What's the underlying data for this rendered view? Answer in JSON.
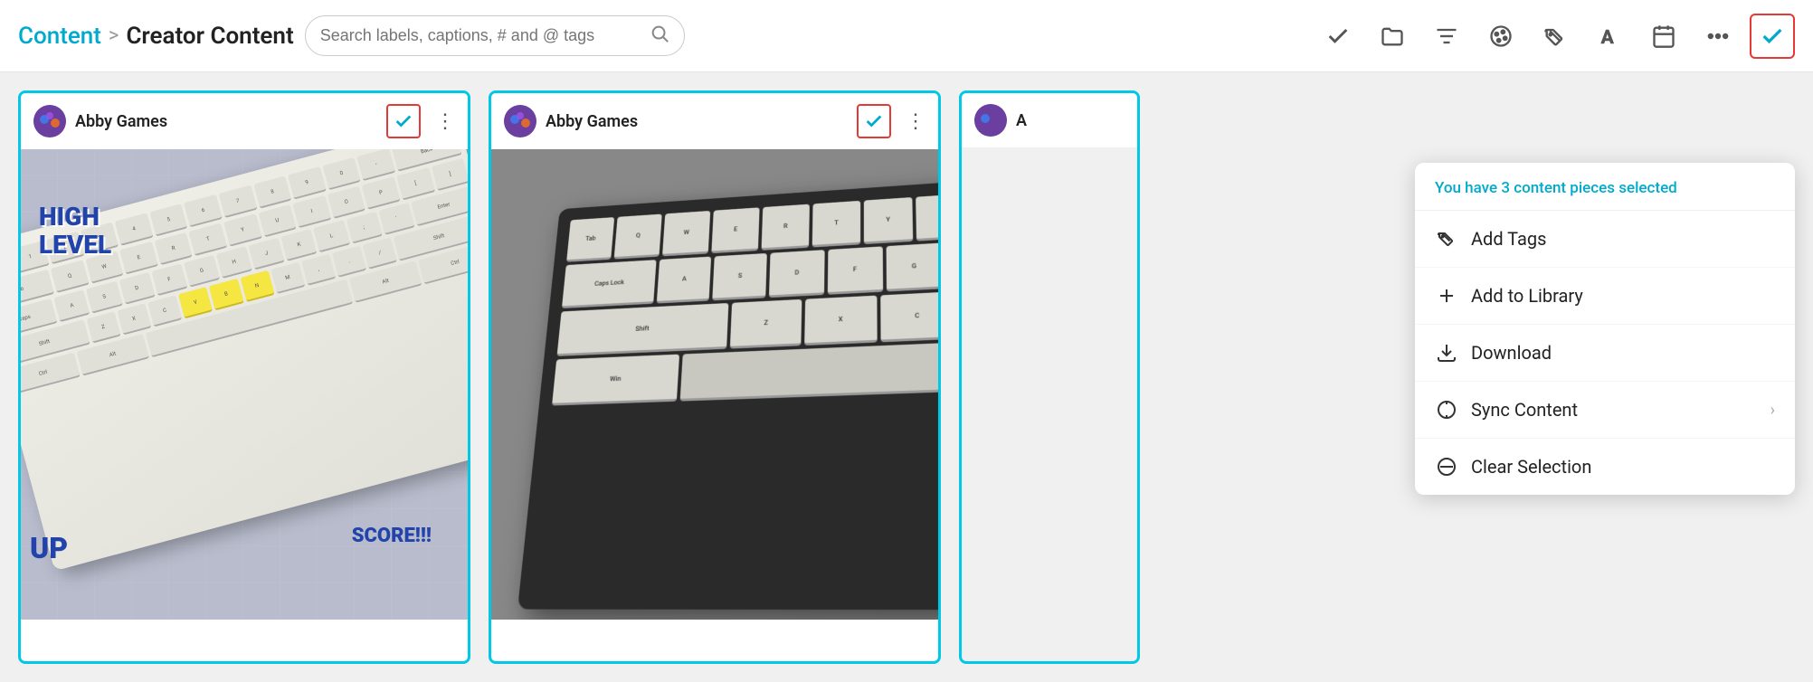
{
  "breadcrumb": {
    "parent": "Content",
    "separator": ">",
    "current": "Creator Content"
  },
  "search": {
    "placeholder": "Search labels, captions, # and @ tags"
  },
  "toolbar": {
    "icons": [
      {
        "name": "checkmark-icon",
        "label": "✓"
      },
      {
        "name": "folder-icon",
        "label": "folder"
      },
      {
        "name": "filter-icon",
        "label": "filter"
      },
      {
        "name": "palette-icon",
        "label": "palette"
      },
      {
        "name": "tag-icon",
        "label": "tags"
      },
      {
        "name": "text-icon",
        "label": "A"
      },
      {
        "name": "calendar-icon",
        "label": "calendar"
      },
      {
        "name": "more-icon",
        "label": "..."
      }
    ]
  },
  "selection_notice": "You have 3 content pieces selected",
  "dropdown_menu": {
    "items": [
      {
        "id": "add-tags",
        "label": "Add Tags",
        "icon": "tag",
        "has_chevron": false
      },
      {
        "id": "add-to-library",
        "label": "Add to Library",
        "icon": "plus",
        "has_chevron": false
      },
      {
        "id": "download",
        "label": "Download",
        "icon": "download",
        "has_chevron": false
      },
      {
        "id": "sync-content",
        "label": "Sync Content",
        "icon": "sync",
        "has_chevron": true
      },
      {
        "id": "clear-selection",
        "label": "Clear Selection",
        "icon": "ban",
        "has_chevron": false
      }
    ]
  },
  "cards": [
    {
      "id": "card-1",
      "user": "Abby Games",
      "selected": true,
      "image_type": "keyboard1"
    },
    {
      "id": "card-2",
      "user": "Abby Games",
      "selected": true,
      "image_type": "keyboard2"
    },
    {
      "id": "card-3",
      "user": "A",
      "selected": false,
      "image_type": "partial"
    }
  ],
  "colors": {
    "accent": "#00c8e6",
    "accent_text": "#00aacc",
    "check_border": "#e53935",
    "check_color": "#00aacc"
  }
}
